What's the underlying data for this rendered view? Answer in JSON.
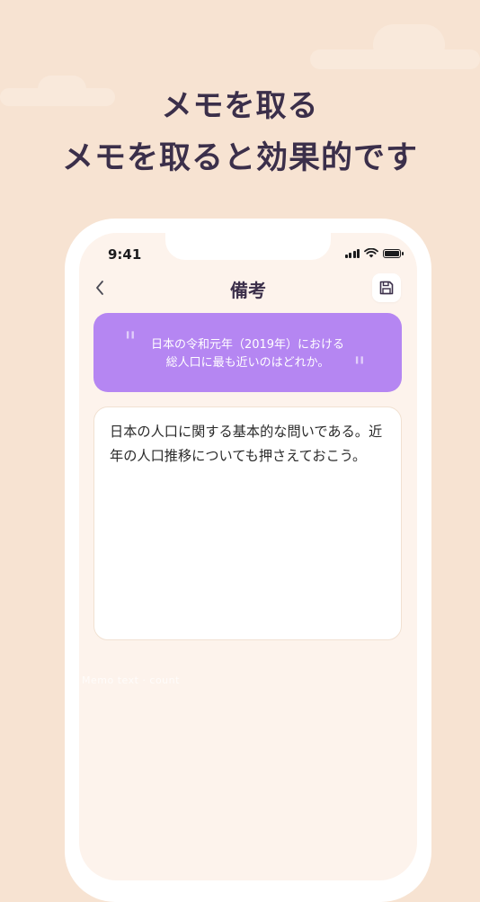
{
  "headline": {
    "line1": "メモを取る",
    "line2": "メモを取ると効果的です"
  },
  "status_bar": {
    "time": "9:41",
    "icons": [
      "signal-icon",
      "wifi-icon",
      "battery-icon"
    ]
  },
  "nav": {
    "title": "備考",
    "back_icon": "chevron-left-icon",
    "save_icon": "floppy-disk-icon"
  },
  "quote": {
    "line1": "日本の令和元年（2019年）における",
    "line2": "総人口に最も近いのはどれか。"
  },
  "memo": {
    "text": "日本の人口に関する基本的な問いである。近年の人口推移についても押さえておこう。"
  },
  "faint_label": "Memo text · count",
  "colors": {
    "background": "#f7e3d2",
    "headline": "#3b2f4a",
    "quote_card": "#b586f2",
    "screen": "#fdf3ec"
  }
}
